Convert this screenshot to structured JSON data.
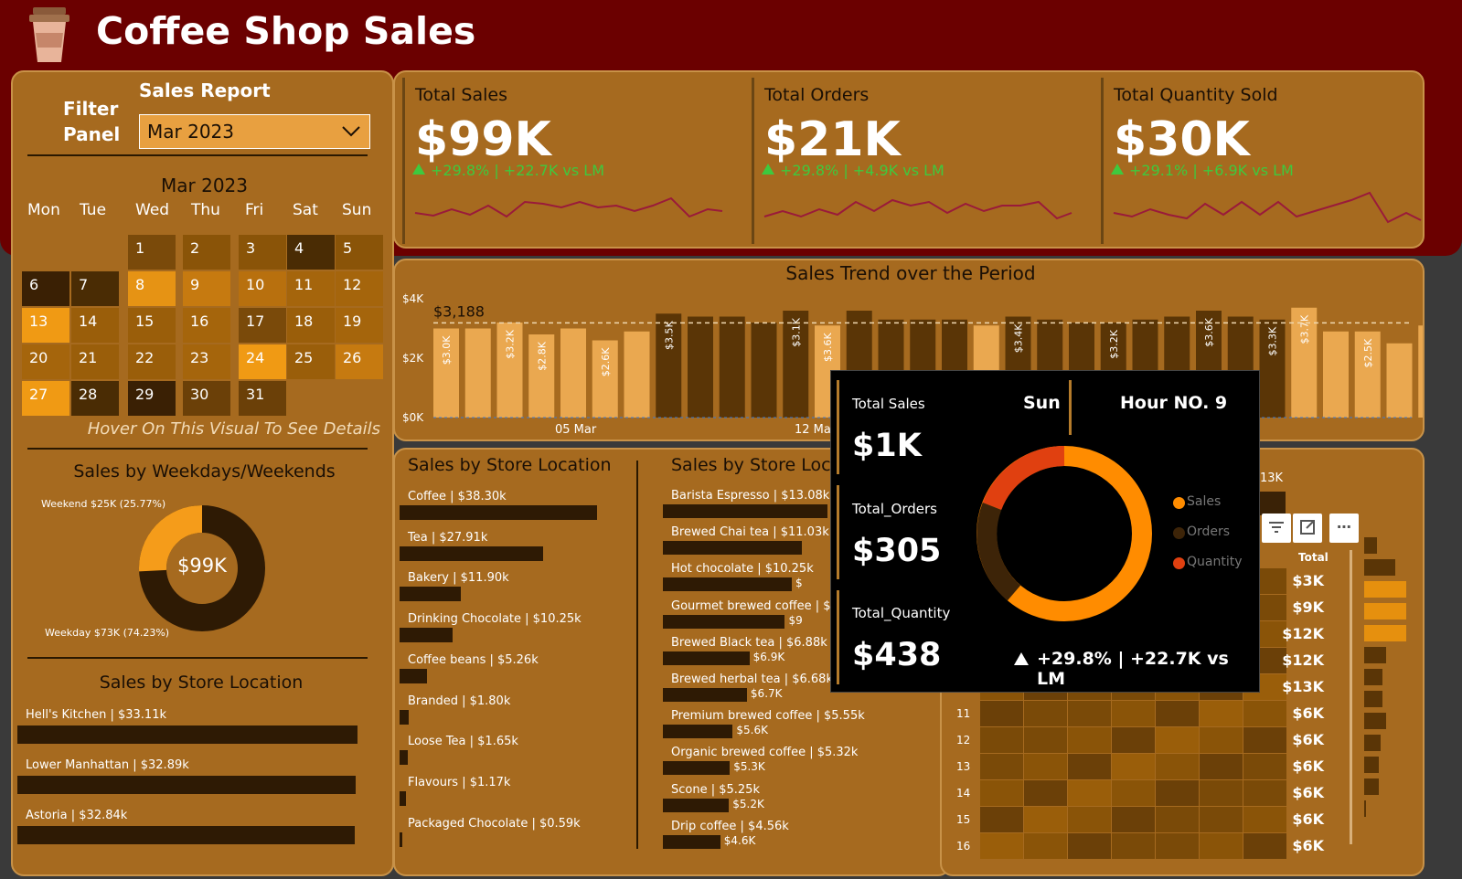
{
  "header": {
    "title": "Coffee Shop Sales",
    "icon": "coffee-cup-icon",
    "band_color": "#6b0000"
  },
  "filter": {
    "title_line1": "Filter",
    "title_line2": "Panel",
    "report_label": "Sales Report",
    "selected_month": "Mar 2023"
  },
  "calendar": {
    "title": "Mar 2023",
    "weekdays": [
      "Mon",
      "Tue",
      "Wed",
      "Thu",
      "Fri",
      "Sat",
      "Sun"
    ],
    "days": [
      "1",
      "2",
      "3",
      "4",
      "5",
      "6",
      "7",
      "8",
      "9",
      "10",
      "11",
      "12",
      "13",
      "14",
      "15",
      "16",
      "17",
      "18",
      "19",
      "20",
      "21",
      "22",
      "23",
      "24",
      "25",
      "26",
      "27",
      "28",
      "29",
      "30",
      "31"
    ],
    "hint": "Hover On This Visual To See Details"
  },
  "weekday_split": {
    "title": "Sales by Weekdays/Weekends",
    "center": "$99K",
    "weekend_label": "Weekend $25K (25.77%)",
    "weekday_label": "Weekday $73K (74.23%)",
    "weekend_share": 25.77
  },
  "locations": {
    "title": "Sales by Store Location",
    "items": [
      {
        "label": "Hell's Kitchen | $33.11k",
        "value": 33.11
      },
      {
        "label": "Lower Manhattan | $32.89k",
        "value": 32.89
      },
      {
        "label": "Astoria | $32.84k",
        "value": 32.84
      }
    ]
  },
  "kpis": [
    {
      "title": "Total Sales",
      "value": "$99K",
      "delta": "+29.8% | +22.7K vs LM"
    },
    {
      "title": "Total Orders",
      "value": "$21K",
      "delta": "+29.8% | +4.9K vs LM"
    },
    {
      "title": "Total Quantity Sold",
      "value": "$30K",
      "delta": "+29.1% | +6.9K vs LM"
    }
  ],
  "trend": {
    "title": "Sales Trend over the Period",
    "avg_label": "$3,188",
    "y_ticks": [
      "$4K",
      "$2K",
      "$0K"
    ],
    "x_ticks": [
      "05 Mar",
      "12 Mar"
    ]
  },
  "store_categories": {
    "title": "Sales by Store Location",
    "items": [
      {
        "label": "Coffee | $38.30k",
        "value": 38.3
      },
      {
        "label": "Tea | $27.91k",
        "value": 27.91
      },
      {
        "label": "Bakery | $11.90k",
        "value": 11.9
      },
      {
        "label": "Drinking Chocolate | $10.25k",
        "value": 10.25
      },
      {
        "label": "Coffee beans | $5.26k",
        "value": 5.26
      },
      {
        "label": "Branded | $1.80k",
        "value": 1.8
      },
      {
        "label": "Loose Tea | $1.65k",
        "value": 1.65
      },
      {
        "label": "Flavours | $1.17k",
        "value": 1.17
      },
      {
        "label": "Packaged Chocolate | $0.59k",
        "value": 0.59
      }
    ]
  },
  "store_products": {
    "title": "Sales by Store Loc",
    "items": [
      {
        "label": "Barista Espresso | $13.08k",
        "value": 13.08,
        "short": "$13"
      },
      {
        "label": "Brewed Chai tea | $11.03k",
        "value": 11.03,
        "short": ""
      },
      {
        "label": "Hot chocolate | $10.25k",
        "value": 10.25,
        "short": "$"
      },
      {
        "label": "Gourmet brewed coffee | $9.7",
        "value": 9.7,
        "short": "$9"
      },
      {
        "label": "Brewed Black tea | $6.88k",
        "value": 6.88,
        "short": "$6.9K"
      },
      {
        "label": "Brewed herbal tea | $6.68k",
        "value": 6.68,
        "short": "$6.7K"
      },
      {
        "label": "Premium brewed coffee | $5.55k",
        "value": 5.55,
        "short": "$5.6K"
      },
      {
        "label": "Organic brewed coffee | $5.32k",
        "value": 5.32,
        "short": "$5.3K"
      },
      {
        "label": "Scone | $5.25k",
        "value": 5.25,
        "short": "$5.2K"
      },
      {
        "label": "Drip coffee | $4.56k",
        "value": 4.56,
        "short": "$4.6K"
      }
    ]
  },
  "tooltip": {
    "sales_label": "Total Sales",
    "sales_value": "$1K",
    "orders_label": "Total_Orders",
    "orders_value": "$305",
    "qty_label": "Total_Quantity",
    "qty_value": "$438",
    "day": "Sun",
    "hour": "Hour NO. 9",
    "delta": "+29.8% | +22.7K vs LM",
    "legend": [
      "Sales",
      "Orders",
      "Quantity"
    ],
    "legend_colors": [
      "#ff8c00",
      "#3d2408",
      "#e04010"
    ]
  },
  "heatmap": {
    "top_label": "13K",
    "day_header": "un",
    "total_header": "Total",
    "totals": [
      "$3K",
      "$9K",
      "$12K",
      "$12K",
      "$13K",
      "$6K",
      "$6K",
      "$6K",
      "$6K",
      "$6K",
      "$6K"
    ],
    "hours": [
      "11",
      "12",
      "13",
      "14",
      "15",
      "16"
    ]
  }
}
